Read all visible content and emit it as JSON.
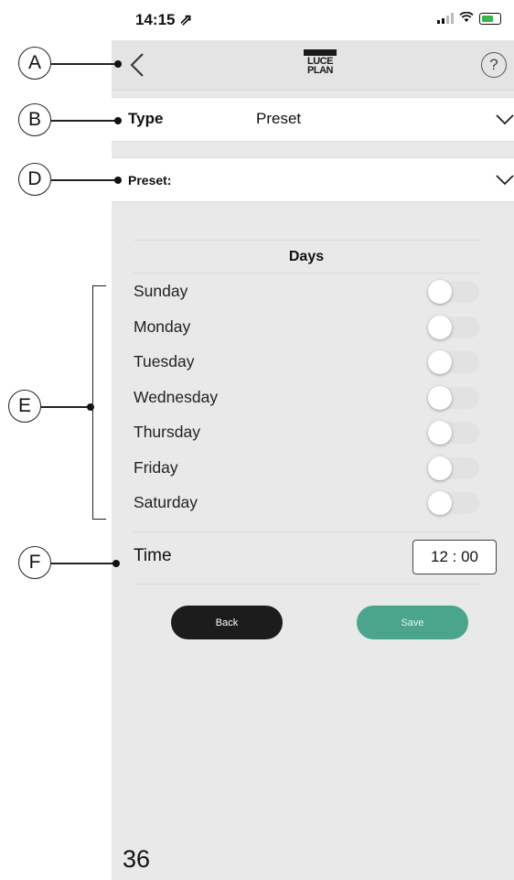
{
  "status_bar": {
    "time": "14:15 ⇗",
    "battery_color": "#39b54a"
  },
  "nav": {
    "back_icon": "chevron-left-icon",
    "logo_line1": "LUCE",
    "logo_line2": "PLAN",
    "help_icon": "question-circle-icon",
    "help_glyph": "?"
  },
  "type_row": {
    "label": "Type",
    "value": "Preset"
  },
  "preset_row": {
    "label": "Preset:"
  },
  "days": {
    "title": "Days",
    "items": [
      {
        "label": "Sunday",
        "on": false
      },
      {
        "label": "Monday",
        "on": false
      },
      {
        "label": "Tuesday",
        "on": false
      },
      {
        "label": "Wednesday",
        "on": false
      },
      {
        "label": "Thursday",
        "on": false
      },
      {
        "label": "Friday",
        "on": false
      },
      {
        "label": "Saturday",
        "on": false
      }
    ]
  },
  "time": {
    "label": "Time",
    "value": "12 : 00"
  },
  "buttons": {
    "back": "Back",
    "save": "Save",
    "save_color": "#4aa58c"
  },
  "page_number": "36",
  "callouts": {
    "a": "A",
    "b": "B",
    "d": "D",
    "e": "E",
    "f": "F"
  }
}
